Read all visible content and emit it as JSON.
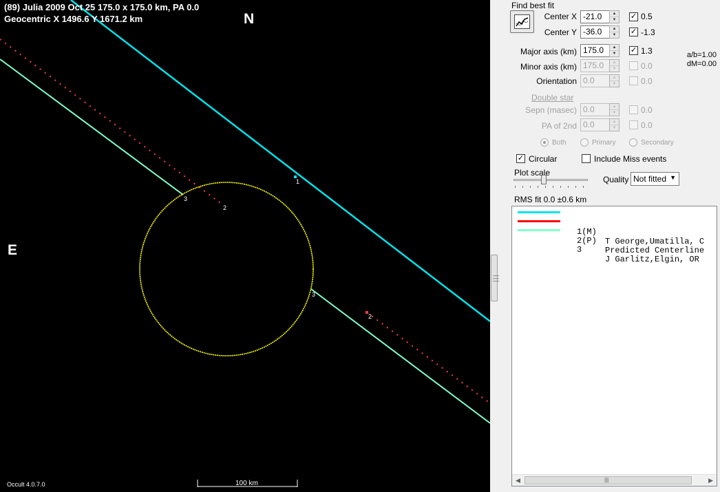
{
  "plot": {
    "header_line1": "(89) Julia  2009 Oct 25   175.0 x 175.0 km, PA 0.0",
    "header_line2": "Geocentric  X  1496.6  Y  1671.2 km",
    "north": "N",
    "east": "E",
    "version": "Occult 4.0.7.0",
    "scale_label": "100 km",
    "chord_labels": {
      "c1": "1",
      "c2a": "2",
      "c2b": "2",
      "c3a": "3",
      "c3b": "3"
    },
    "colors": {
      "chord1": "#00e5ee",
      "chord2": "#ff3c4c",
      "chord3": "#80ffcc",
      "ellipse": "#ffff00"
    }
  },
  "panel": {
    "find_best_fit": "Find best fit",
    "center_x": {
      "label": "Center X",
      "value": "-21.0",
      "fit_value": "0.5"
    },
    "center_y": {
      "label": "Center Y",
      "value": "-36.0",
      "fit_value": "-1.3"
    },
    "major_axis": {
      "label": "Major axis (km)",
      "value": "175.0",
      "fit_value": "1.3"
    },
    "minor_axis": {
      "label": "Minor axis (km)",
      "value": "175.0",
      "fit_value": "0.0"
    },
    "orientation": {
      "label": "Orientation",
      "value": "0.0",
      "fit_value": "0.0"
    },
    "ab_ratio": "a/b=1.00",
    "dm": "dM=0.00",
    "double_star": "Double star",
    "sepn": {
      "label": "Sepn (masec)",
      "value": "0.0",
      "fit_value": "0.0"
    },
    "pa2": {
      "label": "PA of 2nd",
      "value": "0.0",
      "fit_value": "0.0"
    },
    "radios": {
      "both": "Both",
      "primary": "Primary",
      "secondary": "Secondary"
    },
    "circular": "Circular",
    "include_miss": "Include Miss events",
    "plot_scale": "Plot scale",
    "quality_label": "Quality",
    "quality_value": "Not fitted",
    "rms_fit": "RMS fit 0.0 ±0.6 km",
    "check_mark": "✓",
    "list": [
      {
        "id": "1(M)",
        "name": "T George,Umatilla, C",
        "color": "#00e5ee"
      },
      {
        "id": "2(P)",
        "name": "Predicted Centerline",
        "color": "#ff0000"
      },
      {
        "id": "3",
        "name": "J Garlitz,Elgin, OR",
        "color": "#80ffcc"
      }
    ]
  }
}
